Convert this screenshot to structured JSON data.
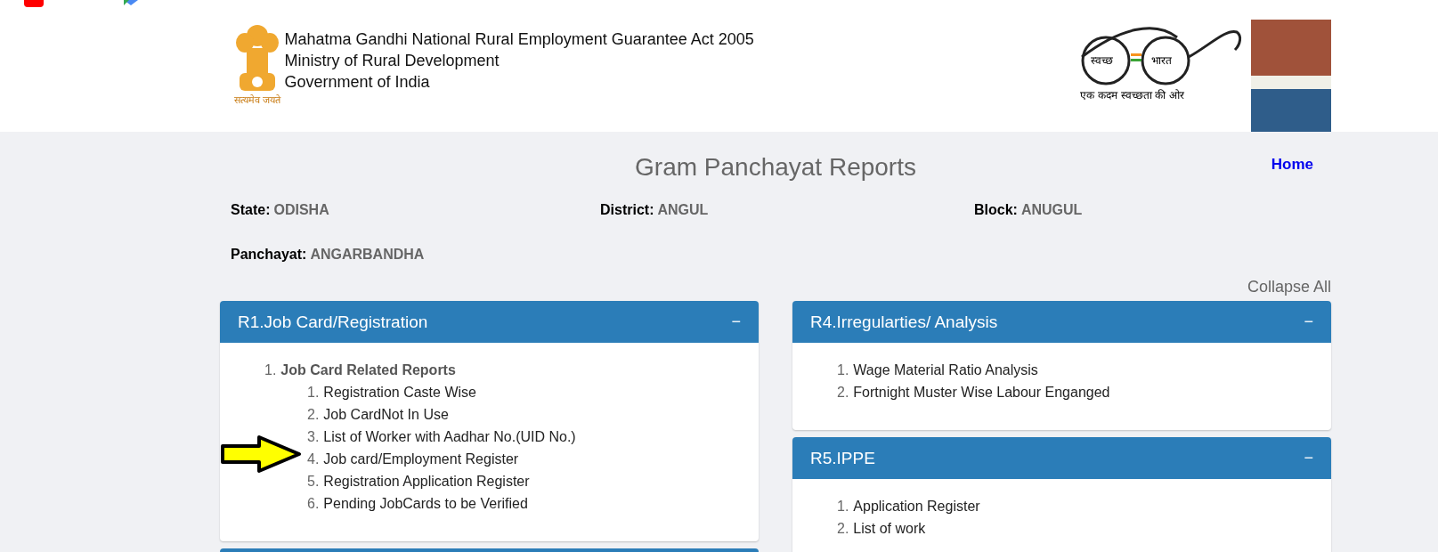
{
  "header": {
    "emblem_caption": "सत्यमेव जयते",
    "lines": [
      "Mahatma Gandhi National Rural Employment Guarantee Act 2005",
      "Ministry of Rural Development",
      "Government of India"
    ],
    "swachh": {
      "left": "स्वच्छ",
      "right": "भारत",
      "tagline": "एक कदम स्वच्छता की ओर"
    }
  },
  "page_title": "Gram Panchayat Reports",
  "home_link": "Home",
  "fields": [
    {
      "label": "State:",
      "value": "ODISHA"
    },
    {
      "label": "District:",
      "value": "ANGUL"
    },
    {
      "label": "Block:",
      "value": "ANUGUL"
    },
    {
      "label": "Panchayat:",
      "value": "ANGARBANDHA"
    }
  ],
  "collapse_all": "Collapse All",
  "columns": [
    [
      {
        "title": "R1.Job Card/Registration",
        "toggle": "−",
        "items": [
          {
            "kind": "group",
            "number": "1.",
            "label": "Job Card Related Reports",
            "children": [
              {
                "number": "1.",
                "label": "Registration Caste Wise"
              },
              {
                "number": "2.",
                "label": "Job CardNot In Use"
              },
              {
                "number": "3.",
                "label": "List of Worker with Aadhar No.(UID No.)"
              },
              {
                "number": "4.",
                "label": "Job card/Employment Register"
              },
              {
                "number": "5.",
                "label": "Registration Application Register"
              },
              {
                "number": "6.",
                "label": "Pending JobCards to be Verified"
              }
            ]
          }
        ]
      }
    ],
    [
      {
        "title": "R4.Irregularties/ Analysis",
        "toggle": "−",
        "items": [
          {
            "kind": "link",
            "number": "1.",
            "label": "Wage Material Ratio Analysis"
          },
          {
            "kind": "link",
            "number": "2.",
            "label": "Fortnight Muster Wise Labour Enganged"
          }
        ]
      },
      {
        "title": "R5.IPPE",
        "toggle": "−",
        "items": [
          {
            "kind": "link",
            "number": "1.",
            "label": "Application Register"
          },
          {
            "kind": "link",
            "number": "2.",
            "label": "List of work"
          }
        ]
      }
    ]
  ]
}
